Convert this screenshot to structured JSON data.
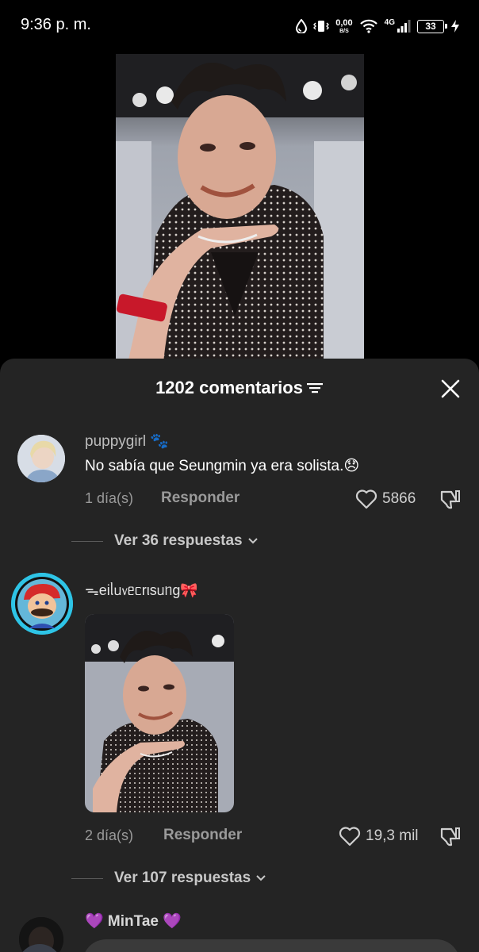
{
  "status_bar": {
    "time": "9:36 p. m.",
    "net_speed_value": "0,00",
    "net_speed_unit": "B/S",
    "network_type": "4G",
    "battery_level": "33",
    "icons": [
      "drop-icon",
      "vibrate-icon",
      "wifi-icon",
      "signal-icon",
      "battery-icon",
      "charging-icon"
    ]
  },
  "video": {
    "thumbnail": "video-frame"
  },
  "comments_sheet": {
    "title": "1202 comentarios",
    "sort_icon": "sort-filter-icon",
    "close_icon": "close-icon",
    "comments": [
      {
        "username": "puppygirl 🐾",
        "text": "No sabía que Seungmin ya era solista.😞",
        "time": "1 día(s)",
        "reply_label": "Responder",
        "likes": "5866",
        "replies_label": "Ver 36 respuestas"
      },
      {
        "username": "ᯓeiᥣᥙ᥎ᥱᥴrιsᥙᥒg🎀",
        "time": "2 día(s)",
        "reply_label": "Responder",
        "likes": "19,3 mil",
        "replies_label": "Ver 107 respuestas"
      },
      {
        "username": "💜 MinTae 💜"
      }
    ]
  },
  "colors": {
    "sheet_background": "#242424",
    "secondary_text": "#9a9a9a",
    "accent_ring": "#2ec4e6"
  }
}
